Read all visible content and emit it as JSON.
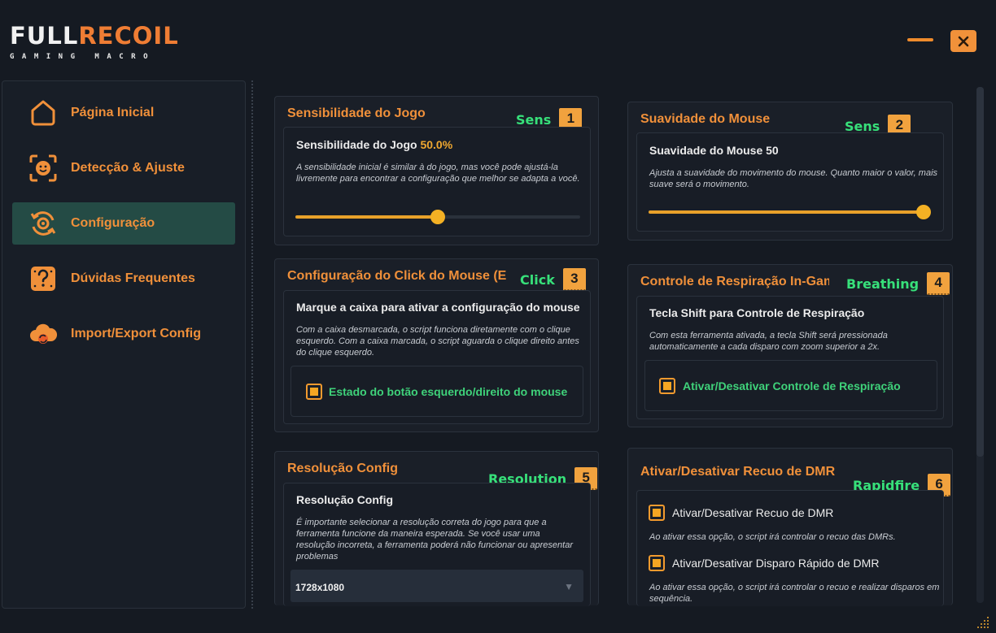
{
  "brand": {
    "main_left": "FULL",
    "main_right": "RECOIL",
    "sub": "GAMING MACRO"
  },
  "window": {
    "minimize_icon": "minimize-icon",
    "close_icon": "close-icon"
  },
  "sidebar": {
    "items": [
      {
        "label": "Página Inicial",
        "icon": "home-icon",
        "active": false
      },
      {
        "label": "Detecção & Ajuste",
        "icon": "face-scan-icon",
        "active": false
      },
      {
        "label": "Configuração",
        "icon": "gear-sync-icon",
        "active": true
      },
      {
        "label": "Dúvidas Frequentes",
        "icon": "question-icon",
        "active": false
      },
      {
        "label": "Import/Export Config",
        "icon": "cloud-sync-icon",
        "active": false
      }
    ]
  },
  "panels": {
    "sens": {
      "title": "Sensibilidade do Jogo",
      "tag": "Sens",
      "num": "1",
      "inner_title": "Sensibilidade do Jogo",
      "value_text": "50.0%",
      "description": "A sensibilidade inicial é similar à do jogo, mas você pode ajustá-la livremente para encontrar a configuração que melhor se adapta a você.",
      "slider_value": 0.5
    },
    "smooth": {
      "title": "Suavidade do Mouse",
      "tag": "Sens",
      "num": "2",
      "inner_title": "Suavidade do Mouse 50",
      "description": "Ajusta a suavidade do movimento do mouse. Quanto maior o valor, mais suave será o movimento.",
      "slider_value": 1.0
    },
    "click": {
      "title": "Configuração do Click do Mouse (Esq",
      "tag": "Click",
      "num": "3",
      "inner_title": "Marque a caixa para ativar a configuração do mouse",
      "description": "Com a caixa desmarcada, o script funciona diretamente com o clique esquerdo. Com a caixa marcada, o script aguarda o clique direito antes do clique esquerdo.",
      "checkbox_label": "Estado do botão esquerdo/direito do mouse",
      "checked": true
    },
    "breathing": {
      "title": "Controle de Respiração In-Game",
      "tag": "Breathing",
      "num": "4",
      "inner_title": "Tecla Shift para Controle de Respiração",
      "description": "Com esta ferramenta ativada, a tecla Shift será pressionada automaticamente a cada disparo com zoom superior a 2x.",
      "checkbox_label": "Ativar/Desativar Controle de Respiração",
      "checked": true
    },
    "resolution": {
      "title": "Resolução Config",
      "tag": "Resolution",
      "num": "5",
      "inner_title": "Resolução Config",
      "description": "É importante selecionar a resolução correta do jogo para que a ferramenta funcione da maneira esperada. Se você usar uma resolução incorreta, a ferramenta poderá não funcionar ou apresentar problemas",
      "selected": "1728x1080"
    },
    "dmr": {
      "title": "Ativar/Desativar Recuo de DMR",
      "tag": "Rapidfire",
      "num": "6",
      "check1_label": "Ativar/Desativar Recuo de DMR",
      "check1_desc": "Ao ativar essa opção, o script irá controlar o recuo das DMRs.",
      "check2_label": "Ativar/Desativar Disparo Rápido de DMR",
      "check2_desc": "Ao ativar essa opção, o script irá controlar o recuo e realizar disparos em sequência.",
      "checked1": true,
      "checked2": true
    }
  },
  "colors": {
    "accent": "#f0903a",
    "green": "#37e07a",
    "active_nav": "#244b45",
    "background": "#151a22"
  }
}
